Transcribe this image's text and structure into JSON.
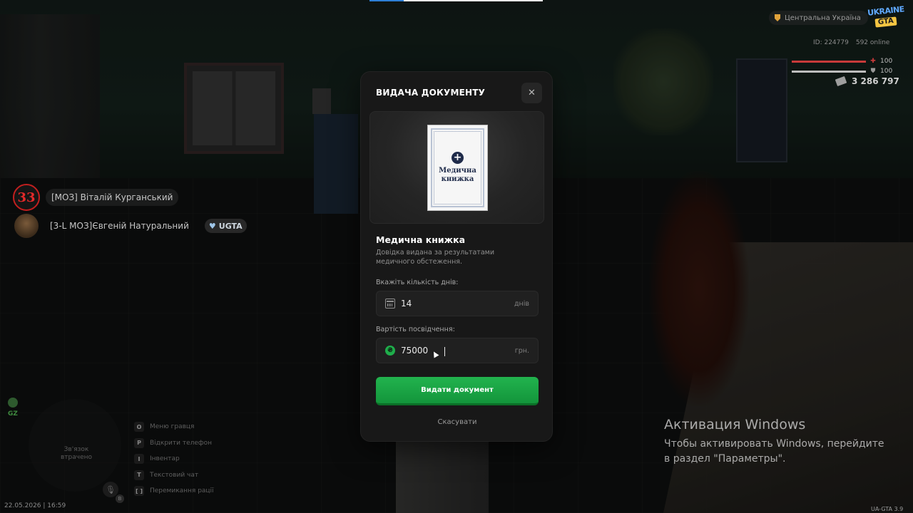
{
  "modal": {
    "title": "ВИДАЧА ДОКУМЕНТУ",
    "close_symbol": "✕",
    "document_card": {
      "plus_symbol": "+",
      "line1": "Медична",
      "line2": "книжка"
    },
    "item_title": "Медична книжка",
    "item_description": "Довідка видана за результатами медичного обстеження.",
    "days_field": {
      "label": "Вкажіть кількість днів:",
      "value": "14",
      "unit": "днів",
      "icon": "calendar-icon"
    },
    "cost_field": {
      "label": "Вартість посвідчення:",
      "value": "75000",
      "unit": "грн.",
      "icon": "hryvnia-coin-icon",
      "currency_symbol": "₴"
    },
    "primary_button": "Видати документ",
    "cancel_link": "Скасувати",
    "accent_color": "#1fae4b"
  },
  "hud": {
    "region": "Центральна Україна",
    "logo": {
      "line1": "UKRAINE",
      "line2": "GTA"
    },
    "player_id": "ID: 224779",
    "online": "592 online",
    "health": {
      "value": "100",
      "fraction": 1.0,
      "color": "#c83a3a",
      "icon": "plus-icon"
    },
    "armor": {
      "value": "100",
      "fraction": 1.0,
      "color": "#bdbdbd",
      "icon": "shield-icon"
    },
    "money": "3 286 797",
    "gz_label": "GZ",
    "radar_text": "Зв'язок втрачено",
    "mic_key": "B",
    "hints": [
      {
        "key": "O",
        "label": "Меню гравця"
      },
      {
        "key": "P",
        "label": "Відкрити телефон"
      },
      {
        "key": "I",
        "label": "Інвентар"
      },
      {
        "key": "T",
        "label": "Текстовий чат"
      },
      {
        "key": "[ ]",
        "label": "Перемикання рації"
      }
    ],
    "datetime": "22.05.2026 | 16:59",
    "version": "UA-GTA 3.9"
  },
  "voice_chat": [
    {
      "avatar": "33",
      "name": "[МОЗ] Віталій Курганський"
    },
    {
      "avatar": "",
      "name": "[3-L МОЗ]Євгеній Натуральний",
      "badge": "UGTA",
      "badge_icon": "heart-icon"
    }
  ],
  "windows_activation": {
    "title": "Активация Windows",
    "message": "Чтобы активировать Windows, перейдите в раздел \"Параметры\"."
  }
}
